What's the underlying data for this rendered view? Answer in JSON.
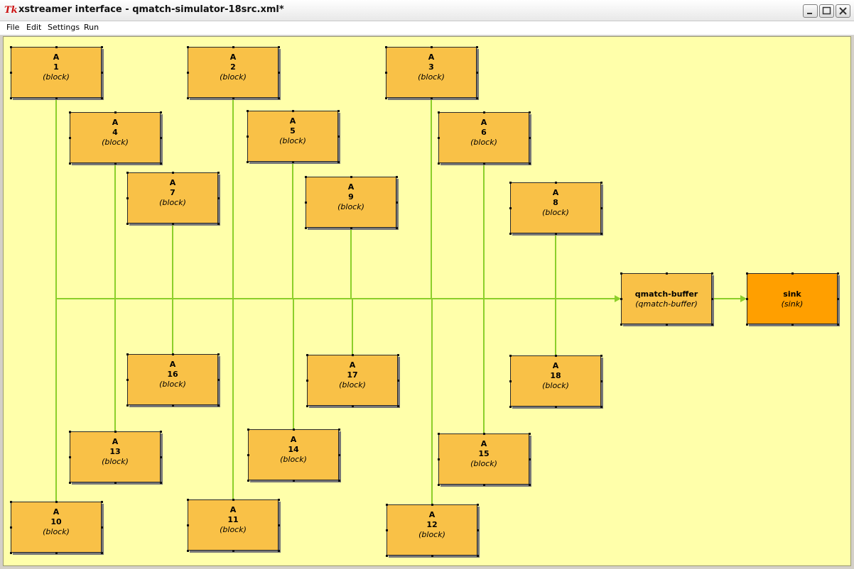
{
  "window": {
    "title": "xstreamer interface - qmatch-simulator-18src.xml*",
    "icon": "tk-feather-icon"
  },
  "menu": [
    "File",
    "Edit",
    "Settings",
    "Run"
  ],
  "colors": {
    "canvas": "#ffffaa",
    "block": "#f9c147",
    "sink_block": "#ff9f00",
    "link": "#8ccf2a"
  },
  "blocks": [
    {
      "name": "A",
      "num": "1",
      "kind": "(block)"
    },
    {
      "name": "A",
      "num": "2",
      "kind": "(block)"
    },
    {
      "name": "A",
      "num": "3",
      "kind": "(block)"
    },
    {
      "name": "A",
      "num": "4",
      "kind": "(block)"
    },
    {
      "name": "A",
      "num": "5",
      "kind": "(block)"
    },
    {
      "name": "A",
      "num": "6",
      "kind": "(block)"
    },
    {
      "name": "A",
      "num": "7",
      "kind": "(block)"
    },
    {
      "name": "A",
      "num": "9",
      "kind": "(block)"
    },
    {
      "name": "A",
      "num": "8",
      "kind": "(block)"
    },
    {
      "name": "A",
      "num": "16",
      "kind": "(block)"
    },
    {
      "name": "A",
      "num": "17",
      "kind": "(block)"
    },
    {
      "name": "A",
      "num": "18",
      "kind": "(block)"
    },
    {
      "name": "A",
      "num": "13",
      "kind": "(block)"
    },
    {
      "name": "A",
      "num": "14",
      "kind": "(block)"
    },
    {
      "name": "A",
      "num": "15",
      "kind": "(block)"
    },
    {
      "name": "A",
      "num": "10",
      "kind": "(block)"
    },
    {
      "name": "A",
      "num": "11",
      "kind": "(block)"
    },
    {
      "name": "A",
      "num": "12",
      "kind": "(block)"
    }
  ],
  "buffer": {
    "name": "qmatch-buffer",
    "kind": "(qmatch-buffer)"
  },
  "sink": {
    "name": "sink",
    "kind": "(sink)"
  }
}
